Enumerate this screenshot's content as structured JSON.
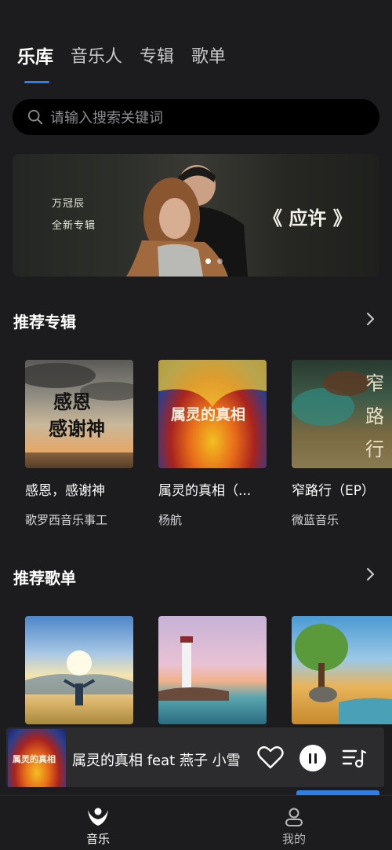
{
  "tabs": [
    {
      "label": "乐库",
      "active": true
    },
    {
      "label": "音乐人",
      "active": false
    },
    {
      "label": "专辑",
      "active": false
    },
    {
      "label": "歌单",
      "active": false
    }
  ],
  "search": {
    "placeholder": "请输入搜索关键词"
  },
  "banner": {
    "artist": "万冠辰",
    "subtitle": "全新专辑",
    "album_title": "《 应许 》",
    "dots": 2,
    "active_dot": 0
  },
  "recommended_albums": {
    "title": "推荐专辑",
    "items": [
      {
        "title": "感恩，感谢神",
        "artist": "歌罗西音乐事工",
        "cover_text": "感恩\n感谢神"
      },
      {
        "title": "属灵的真相（...",
        "artist": "杨航",
        "cover_text": "属灵的真相"
      },
      {
        "title": "窄路行（EP）",
        "artist": "微蓝音乐",
        "cover_text": "窄路行"
      }
    ]
  },
  "recommended_playlists": {
    "title": "推荐歌单"
  },
  "now_playing": {
    "title": "属灵的真相 feat 燕子 小雪",
    "cover_text": "属灵的真相"
  },
  "bottom_nav": [
    {
      "label": "音乐",
      "icon": "music-logo-icon",
      "active": true
    },
    {
      "label": "我的",
      "icon": "profile-icon",
      "active": false
    }
  ],
  "colors": {
    "accent": "#2f7fe8",
    "background": "#1c1c1e"
  }
}
